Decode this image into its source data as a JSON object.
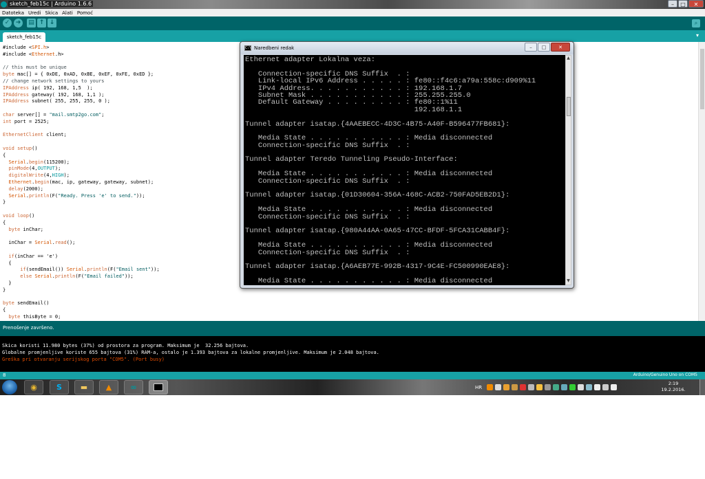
{
  "window": {
    "title": "sketch_feb15c | Arduino 1.6.6",
    "minimize": "–",
    "maximize": "□",
    "close": "✕"
  },
  "menu": [
    "Datoteka",
    "Uredi",
    "Skica",
    "Alati",
    "Pomoć"
  ],
  "toolbar": {
    "verify": "✓",
    "upload": "➜",
    "new": "▤",
    "open": "↑",
    "save": "↓",
    "serial_monitor": "⌕"
  },
  "tab": {
    "label": "sketch_feb15c",
    "menu_glyph": "▾"
  },
  "code_lines": [
    "#include <SPI.h>",
    "#include <Ethernet.h>",
    "",
    "// this must be unique",
    "byte mac[] = { 0xDE, 0xAD, 0xBE, 0xEF, 0xFE, 0xED };",
    "// change network settings to yours",
    "IPAddress ip( 192, 168, 1,5  );",
    "IPAddress gateway( 192, 168, 1,1 );",
    "IPAddress subnet( 255, 255, 255, 0 );",
    "",
    "char server[] = \"mail.smtp2go.com\";",
    "int port = 2525;",
    "",
    "EthernetClient client;",
    "",
    "void setup()",
    "{",
    "  Serial.begin(115200);",
    "  pinMode(4,OUTPUT);",
    "  digitalWrite(4,HIGH);",
    "  Ethernet.begin(mac, ip, gateway, gateway, subnet);",
    "  delay(2000);",
    "  Serial.println(F(\"Ready. Press 'e' to send.\"));",
    "}",
    "",
    "void loop()",
    "{",
    "  byte inChar;",
    "",
    "  inChar = Serial.read();",
    "",
    "  if(inChar == 'e')",
    "  {",
    "      if(sendEmail()) Serial.println(F(\"Email sent\"));",
    "      else Serial.println(F(\"Email failed\"));",
    "  }",
    "}",
    "",
    "byte sendEmail()",
    "{",
    "  byte thisByte = 0;"
  ],
  "status_message": "Prenošenje završeno.",
  "console_lines": [
    {
      "text": "Skica koristi 11.980 bytes (37%) od prostora za program. Maksimum je  32.256 bajtova.",
      "error": false
    },
    {
      "text": "Globalne promjenljive koriste 655 bajtova (31%) RAM-a, ostalo je 1.393 bajtova za lokalne promjenljive. Maksimum je 2.048 bajtova.",
      "error": false
    },
    {
      "text": "Greška pri otvaranju serijskog porta \"COM5\". (Port busy)",
      "error": true
    }
  ],
  "bottom_status": {
    "line_number": "8",
    "board": "Arduino/Genuino Uno on COM5"
  },
  "cmd_window": {
    "title": "Naredbeni redak",
    "icon_text": "C:\\",
    "lines": [
      "Ethernet adapter Lokalna veza:",
      "",
      "   Connection-specific DNS Suffix  . :",
      "   Link-local IPv6 Address . . . . . : fe80::f4c6:a79a:558c:d909%11",
      "   IPv4 Address. . . . . . . . . . . : 192.168.1.7",
      "   Subnet Mask . . . . . . . . . . . : 255.255.255.0",
      "   Default Gateway . . . . . . . . . : fe80::1%11",
      "                                       192.168.1.1",
      "",
      "Tunnel adapter isatap.{4AAEBECC-4D3C-4B75-A40F-B596477FB681}:",
      "",
      "   Media State . . . . . . . . . . . : Media disconnected",
      "   Connection-specific DNS Suffix  . :",
      "",
      "Tunnel adapter Teredo Tunneling Pseudo-Interface:",
      "",
      "   Media State . . . . . . . . . . . : Media disconnected",
      "   Connection-specific DNS Suffix  . :",
      "",
      "Tunnel adapter isatap.{01D30604-356A-468C-ACB2-750FAD5EB2D1}:",
      "",
      "   Media State . . . . . . . . . . . : Media disconnected",
      "   Connection-specific DNS Suffix  . :",
      "",
      "Tunnel adapter isatap.{980A44AA-0A65-47CC-BFDF-5FCA31CABB4F}:",
      "",
      "   Media State . . . . . . . . . . . : Media disconnected",
      "   Connection-specific DNS Suffix  . :",
      "",
      "Tunnel adapter isatap.{A6AEB77E-992B-4317-9C4E-FC500990EAE8}:",
      "",
      "   Media State . . . . . . . . . . . : Media disconnected"
    ]
  },
  "taskbar": {
    "apps": [
      {
        "name": "chrome-icon",
        "glyph": "◉",
        "color": "#e8b730"
      },
      {
        "name": "skype-icon",
        "glyph": "S",
        "color": "#00aff0"
      },
      {
        "name": "folder-icon",
        "glyph": "▬",
        "color": "#f0c75e"
      },
      {
        "name": "vlc-icon",
        "glyph": "▲",
        "color": "#f08a00"
      },
      {
        "name": "arduino-icon",
        "glyph": "∞",
        "color": "#00979c"
      },
      {
        "name": "cmd-icon",
        "glyph": "▪",
        "color": "#000000"
      }
    ],
    "language": "HR",
    "time": "2:19",
    "date": "19.2.2016."
  },
  "colors": {
    "arduino_teal_dark": "#006468",
    "arduino_teal": "#17a1a5",
    "error_orange": "#e34c00"
  }
}
